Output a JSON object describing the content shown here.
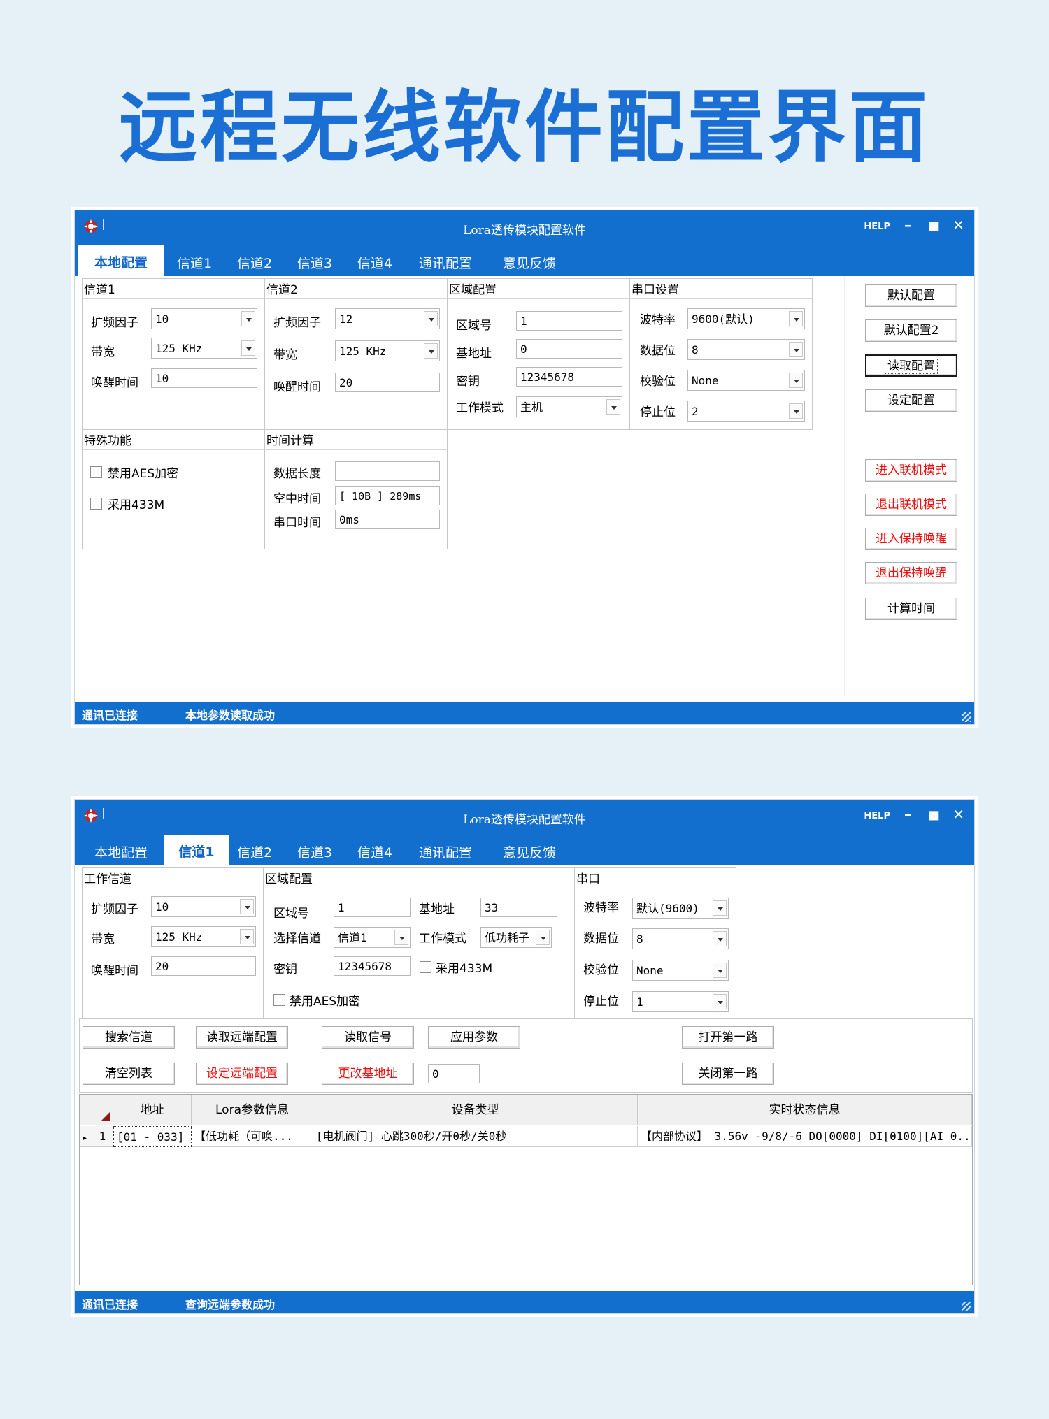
{
  "headline": "远程无线软件配置界面",
  "window1": {
    "title": "Lora透传模块配置软件",
    "help": "HELP",
    "tabs": [
      "本地配置",
      "信道1",
      "信道2",
      "信道3",
      "信道4",
      "通讯配置",
      "意见反馈"
    ],
    "channel1": {
      "title": "信道1",
      "sf_label": "扩频因子",
      "sf": "10",
      "bw_label": "带宽",
      "bw": "125 KHz",
      "wake_label": "唤醒时间",
      "wake": "10"
    },
    "channel2": {
      "title": "信道2",
      "sf_label": "扩频因子",
      "sf": "12",
      "bw_label": "带宽",
      "bw": "125 KHz",
      "wake_label": "唤醒时间",
      "wake": "20"
    },
    "region": {
      "title": "区域配置",
      "zone_label": "区域号",
      "zone": "1",
      "base_label": "基地址",
      "base": "0",
      "key_label": "密钥",
      "key": "12345678",
      "mode_label": "工作模式",
      "mode": "主机"
    },
    "serial": {
      "title": "串口设置",
      "baud_label": "波特率",
      "baud": "9600(默认)",
      "data_label": "数据位",
      "data": "8",
      "parity_label": "校验位",
      "parity": "None",
      "stop_label": "停止位",
      "stop": "2"
    },
    "special": {
      "title": "特殊功能",
      "aes": "禁用AES加密",
      "f433": "采用433M"
    },
    "timecalc": {
      "title": "时间计算",
      "len_label": "数据长度",
      "len": "",
      "air_label": "空中时间",
      "air": "[ 10B ]   289ms",
      "serial_label": "串口时间",
      "serial": "0ms"
    },
    "buttons": {
      "default": "默认配置",
      "default2": "默认配置2",
      "read": "读取配置",
      "set": "设定配置",
      "enter_online": "进入联机模式",
      "exit_online": "退出联机模式",
      "enter_wake": "进入保持唤醒",
      "exit_wake": "退出保持唤醒",
      "calc": "计算时间"
    },
    "status": {
      "left": "通讯已连接",
      "right": "本地参数读取成功"
    }
  },
  "window2": {
    "title": "Lora透传模块配置软件",
    "help": "HELP",
    "tabs": [
      "本地配置",
      "信道1",
      "信道2",
      "信道3",
      "信道4",
      "通讯配置",
      "意见反馈"
    ],
    "work": {
      "title": "工作信道",
      "sf_label": "扩频因子",
      "sf": "10",
      "bw_label": "带宽",
      "bw": "125 KHz",
      "wake_label": "唤醒时间",
      "wake": "20"
    },
    "region": {
      "title": "区域配置",
      "zone_label": "区域号",
      "zone": "1",
      "base_label": "基地址",
      "base": "33",
      "ch_label": "选择信道",
      "ch": "信道1",
      "mode_label": "工作模式",
      "mode": "低功耗子",
      "key_label": "密钥",
      "key": "12345678",
      "f433": "采用433M",
      "aes": "禁用AES加密"
    },
    "serial": {
      "title": "串口",
      "baud_label": "波特率",
      "baud": "默认(9600)",
      "data_label": "数据位",
      "data": "8",
      "parity_label": "校验位",
      "parity": "None",
      "stop_label": "停止位",
      "stop": "1"
    },
    "buttons": {
      "search": "搜索信道",
      "read_remote": "读取远端配置",
      "read_signal": "读取信号",
      "apply": "应用参数",
      "open1": "打开第一路",
      "clear": "清空列表",
      "set_remote": "设定远端配置",
      "change_base": "更改基地址",
      "base_value": "0",
      "close1": "关闭第一路"
    },
    "grid": {
      "headers": [
        "地址",
        "Lora参数信息",
        "设备类型",
        "实时状态信息"
      ],
      "rows": [
        {
          "index": "1",
          "addr": "[01 - 033]",
          "lora": "【低功耗（可唤...",
          "device": "[电机阀门] 心跳300秒/开0秒/关0秒",
          "status": "【内部协议】 3.56v -9/8/-6  DO[0000] DI[0100][AI 0..."
        }
      ]
    },
    "status": {
      "left": "通讯已连接",
      "right": "查询远端参数成功"
    }
  }
}
